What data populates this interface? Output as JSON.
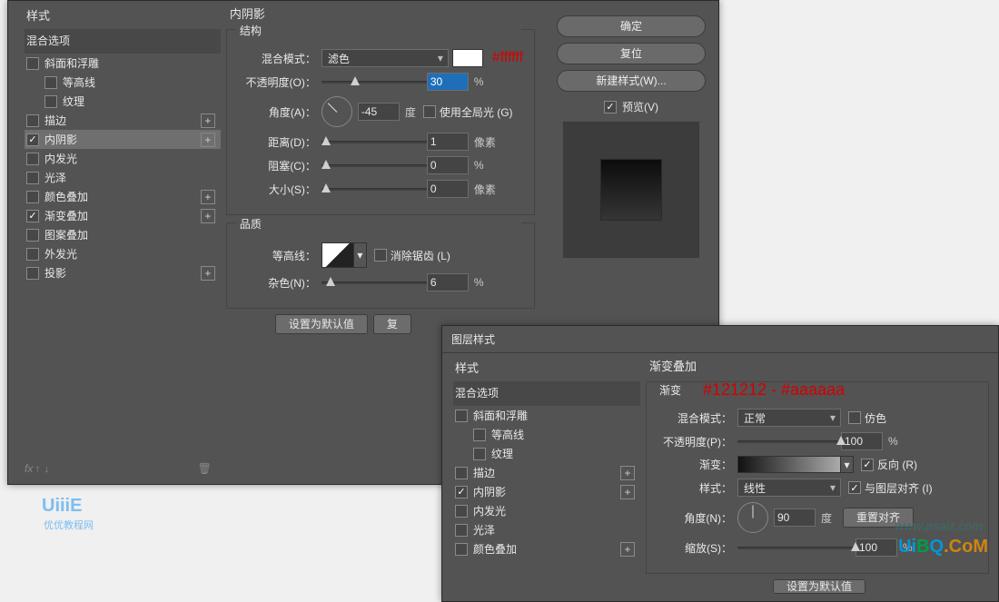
{
  "dialog1": {
    "panel_title": "内阴影",
    "styles_header": "样式",
    "blend_options": "混合选项",
    "style_items": [
      {
        "label": "斜面和浮雕",
        "checked": false,
        "plus": false
      },
      {
        "label": "等高线",
        "checked": false,
        "plus": false,
        "indent": true
      },
      {
        "label": "纹理",
        "checked": false,
        "plus": false,
        "indent": true
      },
      {
        "label": "描边",
        "checked": false,
        "plus": true
      },
      {
        "label": "内阴影",
        "checked": true,
        "plus": true,
        "selected": true
      },
      {
        "label": "内发光",
        "checked": false,
        "plus": false
      },
      {
        "label": "光泽",
        "checked": false,
        "plus": false
      },
      {
        "label": "颜色叠加",
        "checked": false,
        "plus": true
      },
      {
        "label": "渐变叠加",
        "checked": true,
        "plus": true
      },
      {
        "label": "图案叠加",
        "checked": false,
        "plus": false
      },
      {
        "label": "外发光",
        "checked": false,
        "plus": false
      },
      {
        "label": "投影",
        "checked": false,
        "plus": true
      }
    ],
    "structure": {
      "legend": "结构",
      "blend_mode_label": "混合模式：",
      "blend_mode_value": "滤色",
      "color_annot": "#ffffff",
      "opacity_label": "不透明度(O)：",
      "opacity_value": "30",
      "opacity_pct": 30,
      "angle_label": "角度(A)：",
      "angle_value": "-45",
      "angle_unit": "度",
      "use_global_light": "使用全局光 (G)",
      "distance_label": "距离(D)：",
      "distance_value": "1",
      "choke_label": "阻塞(C)：",
      "choke_value": "0",
      "size_label": "大小(S)：",
      "size_value": "0",
      "px": "像素"
    },
    "quality": {
      "legend": "品质",
      "contour_label": "等高线：",
      "anti_alias": "消除锯齿 (L)",
      "noise_label": "杂色(N)：",
      "noise_value": "6"
    },
    "set_default": "设置为默认值",
    "reset_default": "复",
    "btn_ok": "确定",
    "btn_cancel": "复位",
    "btn_newstyle": "新建样式(W)...",
    "preview_label": "预览(V)",
    "fx_label": "fx",
    "pct": "%"
  },
  "dialog2": {
    "title": "图层样式",
    "panel_title": "渐变叠加",
    "styles_header": "样式",
    "blend_options": "混合选项",
    "style_items": [
      {
        "label": "斜面和浮雕",
        "checked": false,
        "plus": false
      },
      {
        "label": "等高线",
        "checked": false,
        "plus": false,
        "indent": true
      },
      {
        "label": "纹理",
        "checked": false,
        "plus": false,
        "indent": true
      },
      {
        "label": "描边",
        "checked": false,
        "plus": true
      },
      {
        "label": "内阴影",
        "checked": true,
        "plus": true
      },
      {
        "label": "内发光",
        "checked": false,
        "plus": false
      },
      {
        "label": "光泽",
        "checked": false,
        "plus": false
      },
      {
        "label": "颜色叠加",
        "checked": false,
        "plus": true
      }
    ],
    "gradient": {
      "legend": "渐变",
      "annotation": "#121212 - #aaaaaa",
      "blend_mode_label": "混合模式：",
      "blend_mode_value": "正常",
      "dither": "仿色",
      "opacity_label": "不透明度(P)：",
      "opacity_value": "100",
      "gradient_label": "渐变：",
      "reverse": "反向 (R)",
      "style_label": "样式：",
      "style_value": "线性",
      "align_layer": "与图层对齐 (I)",
      "angle_label": "角度(N)：",
      "angle_value": "90",
      "angle_unit": "度",
      "reset_align": "重置对齐",
      "scale_label": "缩放(S)：",
      "scale_value": "100"
    },
    "set_default": "设置为默认值",
    "pct": "%"
  },
  "watermarks": {
    "uiii": "UiiiE",
    "uiii_sub": "优优教程网",
    "uibq": "UiBQ.CoM",
    "ps": "www.psaiz.com"
  }
}
